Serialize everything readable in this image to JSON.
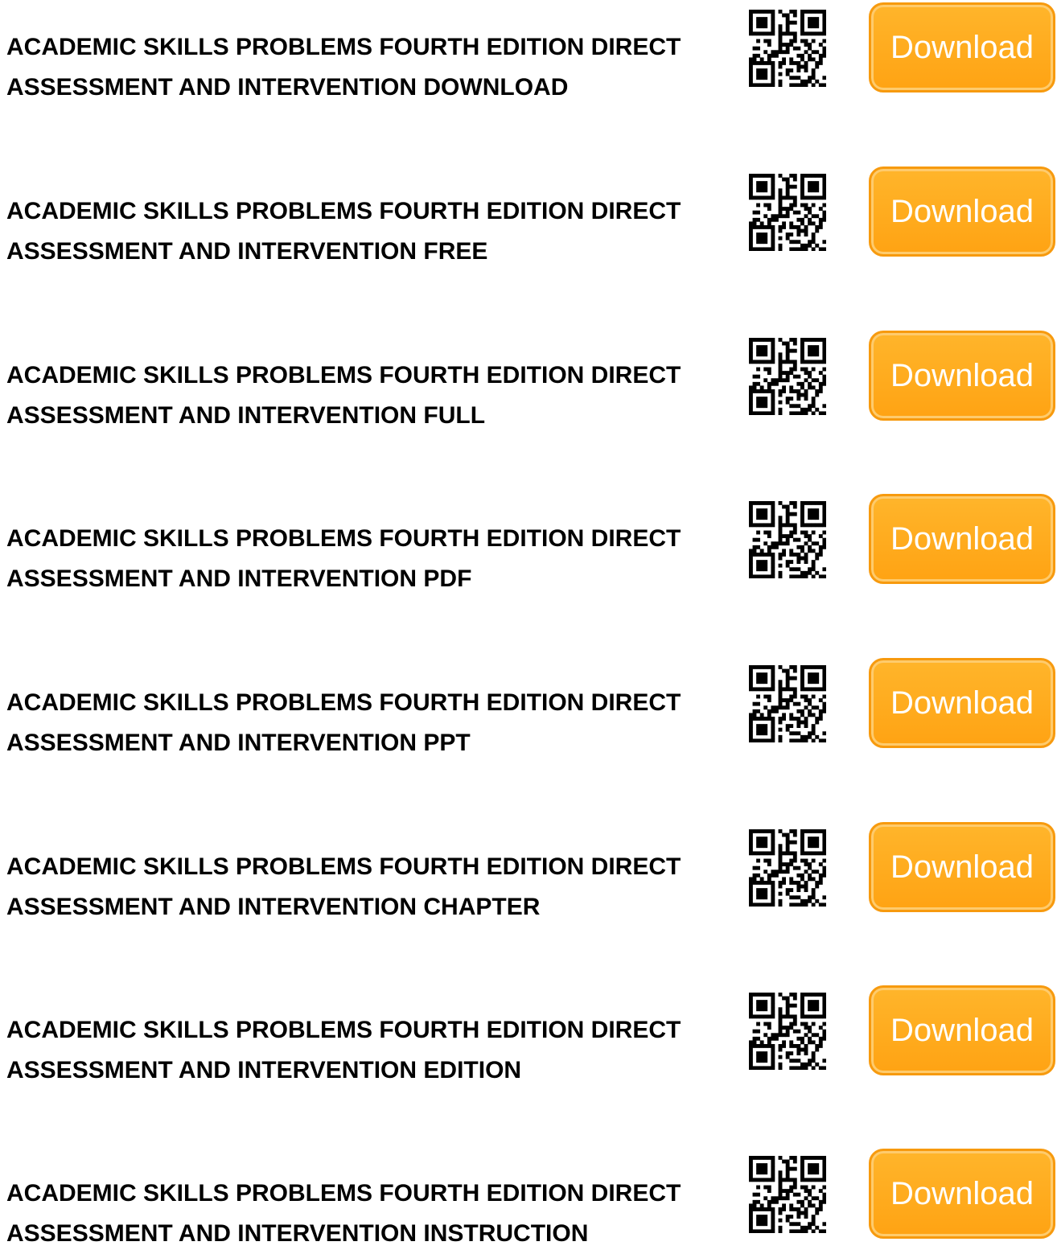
{
  "items": [
    {
      "line1": "ACADEMIC SKILLS PROBLEMS FOURTH EDITION DIRECT",
      "line2": "ASSESSMENT AND INTERVENTION DOWNLOAD",
      "button_label": "Download"
    },
    {
      "line1": "ACADEMIC SKILLS PROBLEMS FOURTH EDITION DIRECT",
      "line2": "ASSESSMENT AND INTERVENTION FREE",
      "button_label": "Download"
    },
    {
      "line1": "ACADEMIC SKILLS PROBLEMS FOURTH EDITION DIRECT",
      "line2": "ASSESSMENT AND INTERVENTION FULL",
      "button_label": "Download"
    },
    {
      "line1": "ACADEMIC SKILLS PROBLEMS FOURTH EDITION DIRECT",
      "line2": "ASSESSMENT AND INTERVENTION PDF",
      "button_label": "Download"
    },
    {
      "line1": "ACADEMIC SKILLS PROBLEMS FOURTH EDITION DIRECT",
      "line2": "ASSESSMENT AND INTERVENTION PPT",
      "button_label": "Download"
    },
    {
      "line1": "ACADEMIC SKILLS PROBLEMS FOURTH EDITION DIRECT",
      "line2": "ASSESSMENT AND INTERVENTION CHAPTER",
      "button_label": "Download"
    },
    {
      "line1": "ACADEMIC SKILLS PROBLEMS FOURTH EDITION DIRECT",
      "line2": "ASSESSMENT AND INTERVENTION EDITION",
      "button_label": "Download"
    },
    {
      "line1": "ACADEMIC SKILLS PROBLEMS FOURTH EDITION DIRECT",
      "line2": "ASSESSMENT AND INTERVENTION INSTRUCTION",
      "button_label": "Download"
    }
  ],
  "icons": {
    "qr": "qr-code-icon"
  },
  "colors": {
    "title_text": "#000000",
    "button_fill": "#ffa313",
    "button_border": "#f79a0e",
    "button_text": "#ffffff"
  }
}
